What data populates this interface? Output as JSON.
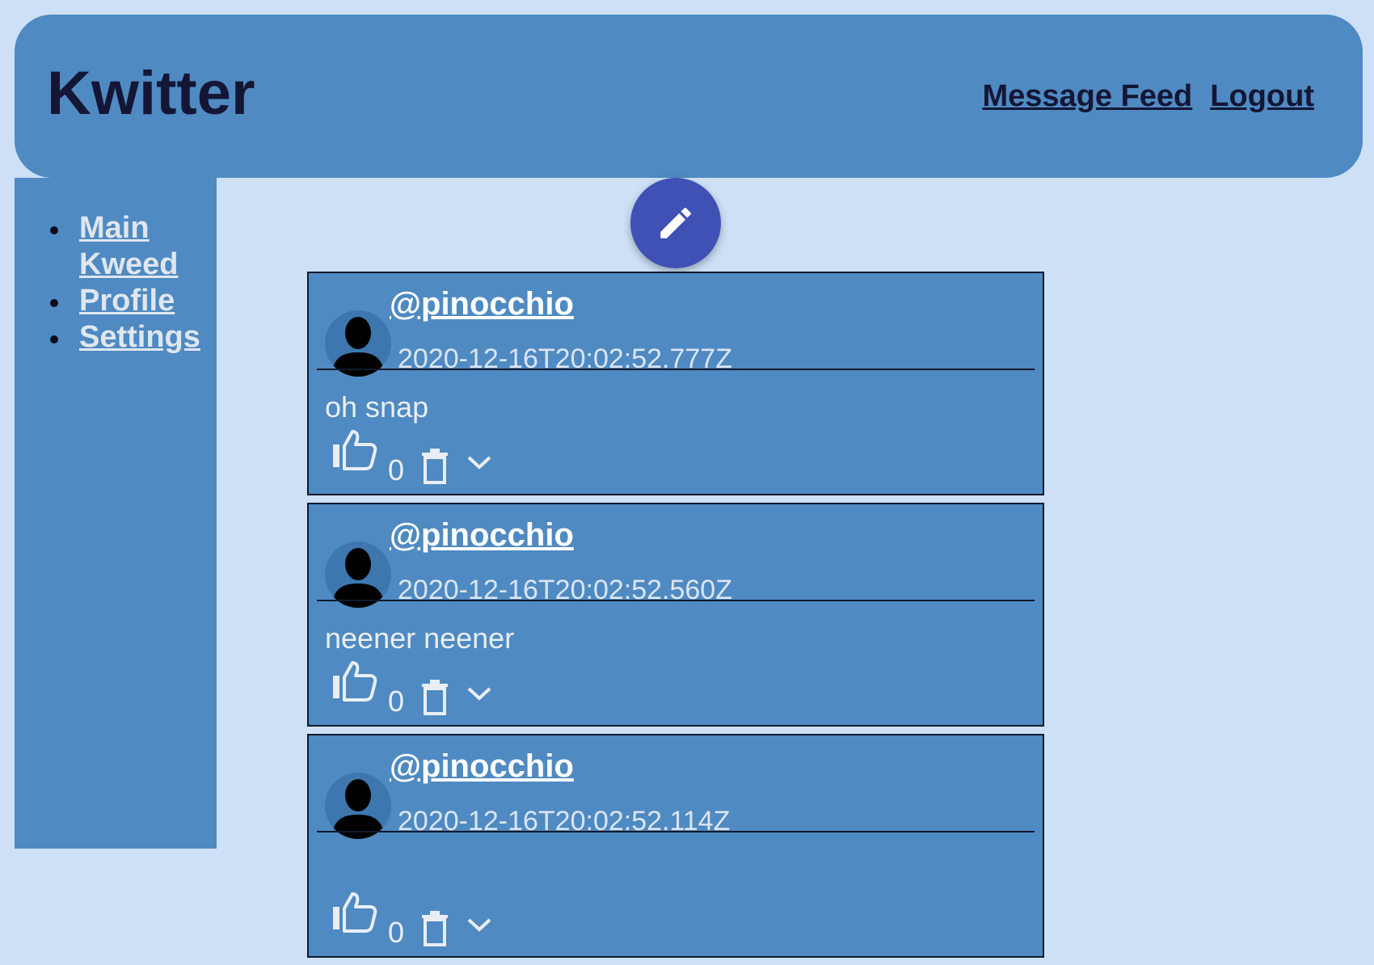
{
  "header": {
    "title": "Kwitter",
    "nav": [
      "Message Feed",
      "Logout"
    ]
  },
  "sidebar": {
    "items": [
      {
        "label": "Main Kweed"
      },
      {
        "label": "Profile"
      },
      {
        "label": "Settings"
      }
    ]
  },
  "compose": {
    "icon": "pencil-icon"
  },
  "feed": {
    "kweeds": [
      {
        "username": "@pinocchio",
        "timestamp": "2020-12-16T20:02:52.777Z",
        "text": "oh snap",
        "likes": "0"
      },
      {
        "username": "@pinocchio",
        "timestamp": "2020-12-16T20:02:52.560Z",
        "text": "neener neener",
        "likes": "0"
      },
      {
        "username": "@pinocchio",
        "timestamp": "2020-12-16T20:02:52.114Z",
        "text": "",
        "likes": "0"
      }
    ]
  },
  "colors": {
    "background": "#cde0f6",
    "panel": "#4f8ac2",
    "fab": "#3f51b5",
    "title": "#141635"
  }
}
